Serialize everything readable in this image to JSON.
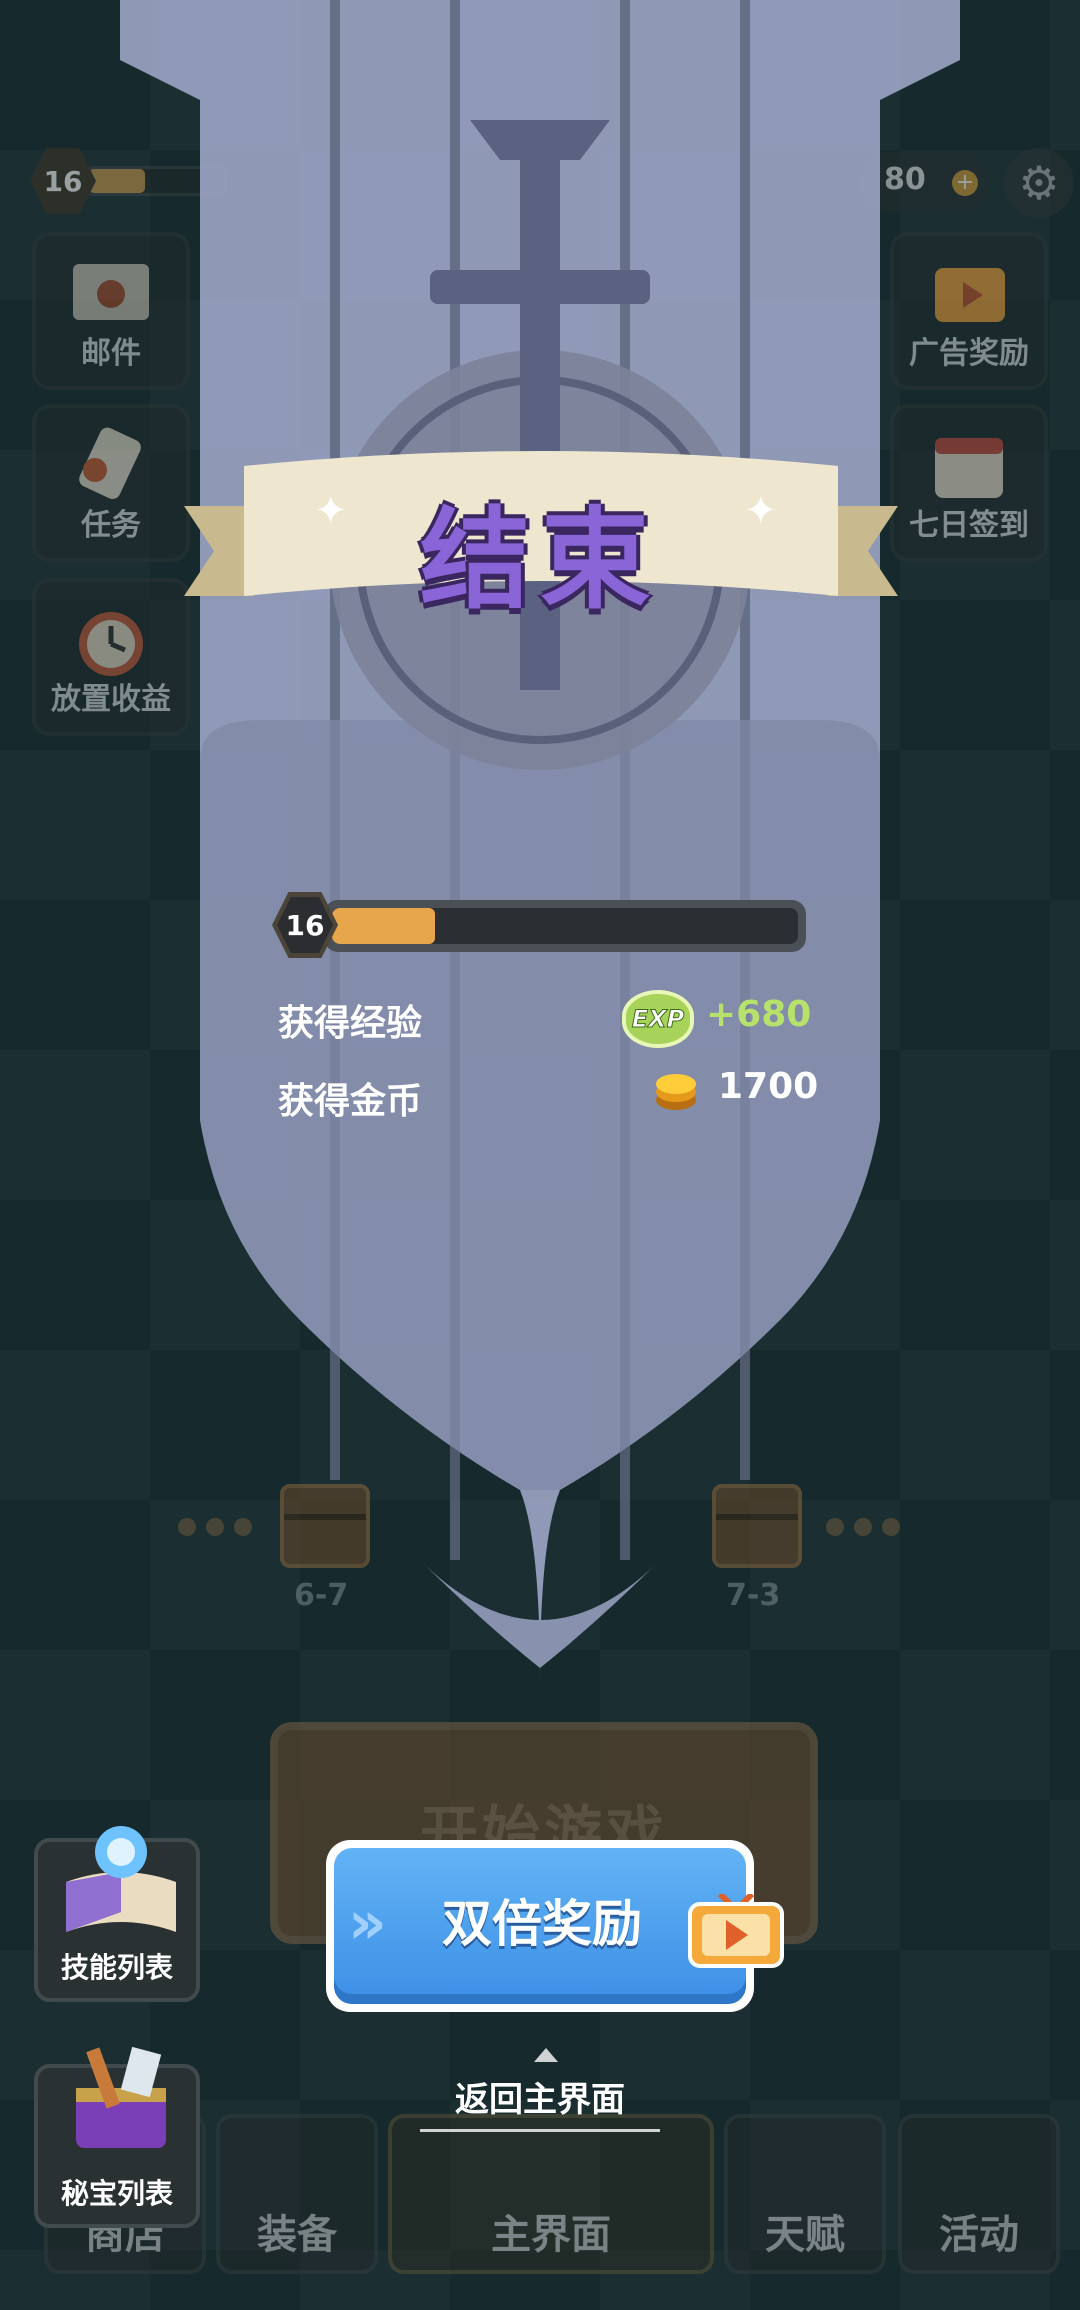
{
  "top_bar": {
    "level": "16",
    "level_progress": 0.42,
    "coins": "80",
    "coins_add_icon": "plus-icon",
    "settings_icon": "gear-icon"
  },
  "left_menu": [
    {
      "label": "邮件",
      "icon": "mail-icon"
    },
    {
      "label": "任务",
      "icon": "scroll-icon"
    },
    {
      "label": "放置收益",
      "icon": "stopwatch-icon"
    }
  ],
  "right_menu": [
    {
      "label": "广告奖励",
      "icon": "tv-play-icon"
    },
    {
      "label": "七日签到",
      "icon": "calendar-icon"
    }
  ],
  "result": {
    "title": "结束",
    "level": "16",
    "level_progress": 0.22,
    "rewards": [
      {
        "label": "获得经验",
        "value": "+680",
        "icon": "exp-icon",
        "badge": "EXP",
        "color": "#b6e26b"
      },
      {
        "label": "获得金币",
        "value": "1700",
        "icon": "gold-coin-icon",
        "color": "#ffffff"
      }
    ]
  },
  "map": {
    "stages": [
      {
        "label": "6-7"
      },
      {
        "label": "7-3"
      }
    ]
  },
  "start_button": {
    "label": "开始游戏"
  },
  "double_reward_button": {
    "label": "双倍奖励",
    "icon": "tv-play-icon"
  },
  "back_to_main": {
    "label": "返回主界面"
  },
  "side_tools": [
    {
      "label": "技能列表",
      "icon": "skill-book-icon"
    },
    {
      "label": "秘宝列表",
      "icon": "treasure-chest-icon"
    }
  ],
  "bottom_nav": [
    {
      "label": "商店"
    },
    {
      "label": "装备"
    },
    {
      "label": "主界面"
    },
    {
      "label": "天赋"
    },
    {
      "label": "活动"
    }
  ],
  "colors": {
    "accent_blue": "#4a9ff0",
    "ribbon_text": "#8a65d8",
    "exp_green": "#b6e26b",
    "progress_orange": "#e7a64b"
  }
}
